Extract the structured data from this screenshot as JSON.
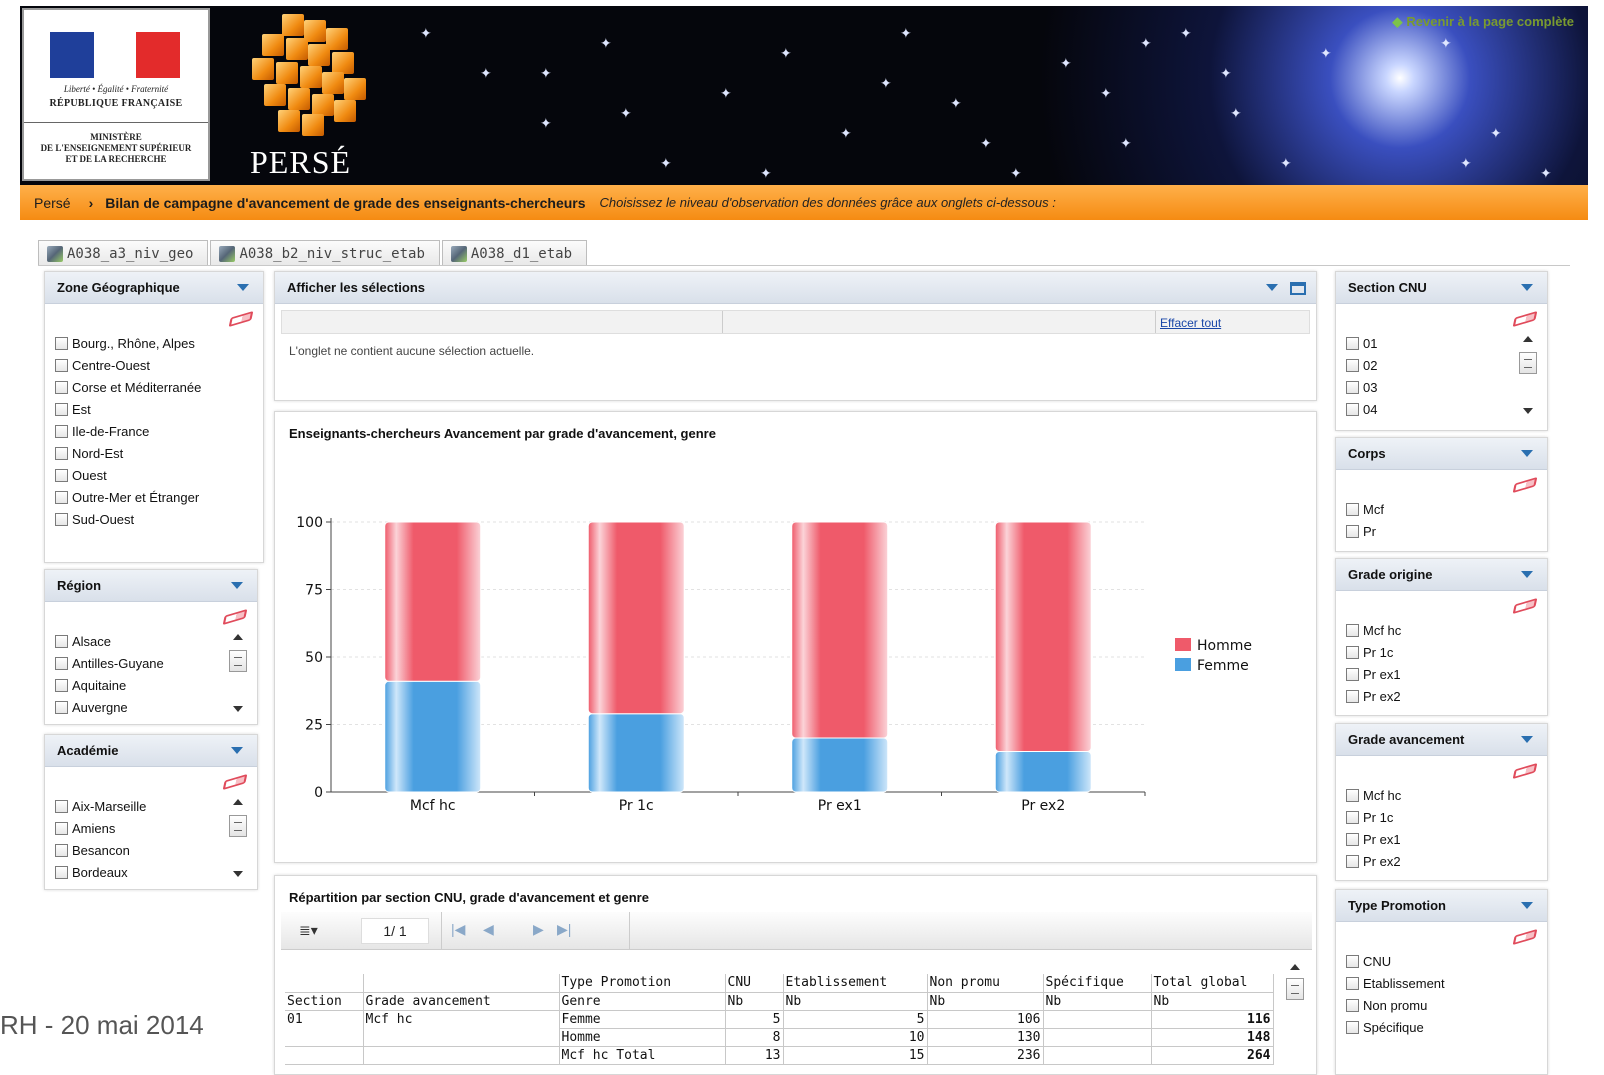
{
  "header": {
    "gov_motto": "Liberté • Égalité • Fraternité",
    "gov_republic": "RÉPUBLIQUE FRANÇAISE",
    "gov_ministry": [
      "MINISTÈRE",
      "DE L'ENSEIGNEMENT SUPÉRIEUR",
      "ET DE LA RECHERCHE"
    ],
    "app_name": "PERSÉ",
    "back_link": "Revenir à la page complète"
  },
  "breadcrumb": {
    "root": "Persé",
    "separator": "›",
    "title": "Bilan de campagne d'avancement de grade des enseignants-chercheurs",
    "hint": "Choisissez le niveau d'observation des données grâce aux onglets ci-dessous :"
  },
  "tabs": [
    "A038_a3_niv_geo",
    "A038_b2_niv_struc_etab",
    "A038_d1_etab"
  ],
  "filters": {
    "zone": {
      "title": "Zone Géographique",
      "items": [
        "Bourg., Rhône, Alpes",
        "Centre-Ouest",
        "Corse et Méditerranée",
        "Est",
        "Ile-de-France",
        "Nord-Est",
        "Ouest",
        "Outre-Mer et Étranger",
        "Sud-Ouest"
      ]
    },
    "region": {
      "title": "Région",
      "items": [
        "Alsace",
        "Antilles-Guyane",
        "Aquitaine",
        "Auvergne"
      ]
    },
    "academie": {
      "title": "Académie",
      "items": [
        "Aix-Marseille",
        "Amiens",
        "Besancon",
        "Bordeaux"
      ]
    },
    "section_cnu": {
      "title": "Section CNU",
      "items": [
        "01",
        "02",
        "03",
        "04"
      ]
    },
    "corps": {
      "title": "Corps",
      "items": [
        "Mcf",
        "Pr"
      ]
    },
    "grade_origine": {
      "title": "Grade origine",
      "items": [
        "Mcf hc",
        "Pr 1c",
        "Pr ex1",
        "Pr ex2"
      ]
    },
    "grade_avancement": {
      "title": "Grade avancement",
      "items": [
        "Mcf hc",
        "Pr 1c",
        "Pr ex1",
        "Pr ex2"
      ]
    },
    "type_promotion": {
      "title": "Type Promotion",
      "items": [
        "CNU",
        "Etablissement",
        "Non promu",
        "Spécifique"
      ]
    }
  },
  "selections": {
    "title": "Afficher les sélections",
    "clear_all": "Effacer tout",
    "message": "L'onglet ne contient aucune sélection actuelle."
  },
  "chart_panel": {
    "title": "Enseignants-chercheurs Avancement par grade d'avancement, genre"
  },
  "chart_data": {
    "type": "bar",
    "stacked": true,
    "title": "Enseignants-chercheurs Avancement par grade d'avancement, genre",
    "categories": [
      "Mcf hc",
      "Pr 1c",
      "Pr ex1",
      "Pr ex2"
    ],
    "series": [
      {
        "name": "Femme",
        "color": "#4a9fe0",
        "values": [
          41,
          29,
          20,
          15
        ]
      },
      {
        "name": "Homme",
        "color": "#ef5a6a",
        "values": [
          59,
          71,
          80,
          85
        ]
      }
    ],
    "legend_order": [
      "Homme",
      "Femme"
    ],
    "legend_position": "right",
    "ylim": [
      0,
      100
    ],
    "yticks": [
      "0",
      "25",
      "50",
      "75",
      "100"
    ],
    "grid": true
  },
  "table_panel": {
    "title": "Répartition par section CNU, grade d'avancement et genre",
    "page": "1/ 1",
    "header_row1": [
      "",
      "",
      "Type Promotion",
      "CNU",
      "Etablissement",
      "Non promu",
      "Spécifique",
      "Total global"
    ],
    "header_row2": [
      "Section",
      "Grade avancement",
      "Genre",
      "Nb",
      "Nb",
      "Nb",
      "Nb",
      "Nb"
    ],
    "rows": [
      [
        "01",
        "Mcf hc",
        "Femme",
        "5",
        "5",
        "106",
        "",
        "116"
      ],
      [
        "",
        "",
        "Homme",
        "8",
        "10",
        "130",
        "",
        "148"
      ],
      [
        "",
        "",
        "Mcf hc Total",
        "13",
        "15",
        "236",
        "",
        "264"
      ]
    ]
  },
  "footer": {
    "text": "RH - 20 mai 2014"
  }
}
